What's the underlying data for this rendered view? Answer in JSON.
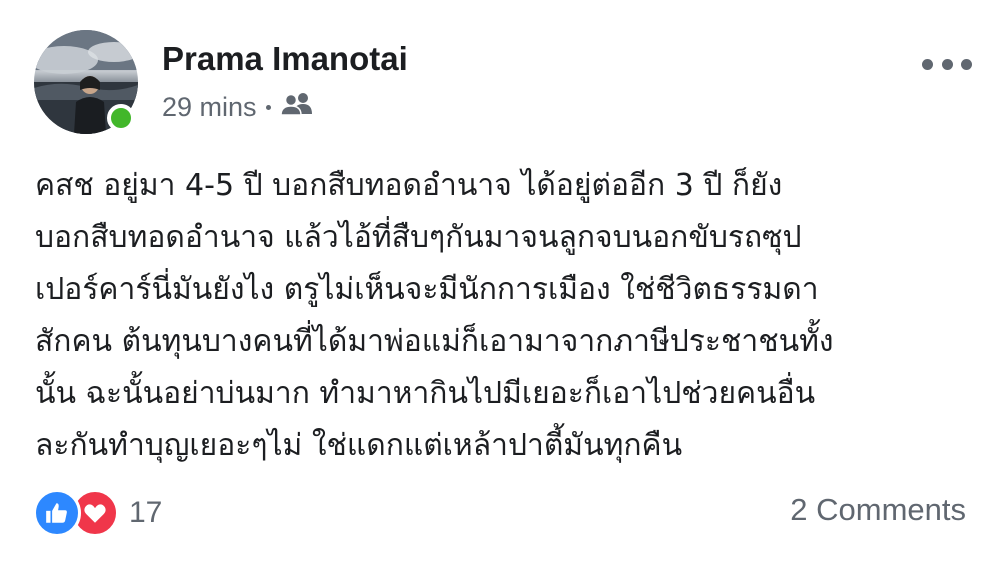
{
  "post": {
    "author": "Prama Imanotai",
    "timestamp": "29 mins",
    "audience_icon": "friends-icon",
    "more_icon": "more-options-icon",
    "online_status_color": "#42b72a",
    "text_lines": [
      "คสช อยู่มา 4-5 ปี บอกสืบทอดอำนาจ ได้อยู่ต่ออีก 3 ปี ก็ยัง",
      "บอกสืบทอดอำนาจ แล้วไอ้ที่สืบๆกันมาจนลูกจบนอกขับรถซุป",
      "เปอร์คาร์นี่มันยังไง ตรูไม่เห็นจะมีนักการเมือง ใช่ชีวิตธรรมดา",
      "สักคน ต้นทุนบางคนที่ได้มาพ่อแม่ก็เอามาจากภาษีประชาชนทั้ง",
      "นั้น ฉะนั้นอย่าบ่นมาก ทำมาหากินไปมีเยอะก็เอาไปช่วยคนอื่น",
      "ละกันทำบุญเยอะๆไม่ ใช่แดกแต่เหล้าปาตี้มันทุกคืน"
    ]
  },
  "footer": {
    "reactions": [
      "like-icon",
      "love-icon"
    ],
    "like_color": "#2d88ff",
    "love_color": "#f0364a",
    "reaction_count": "17",
    "comments_label": "2 Comments"
  }
}
